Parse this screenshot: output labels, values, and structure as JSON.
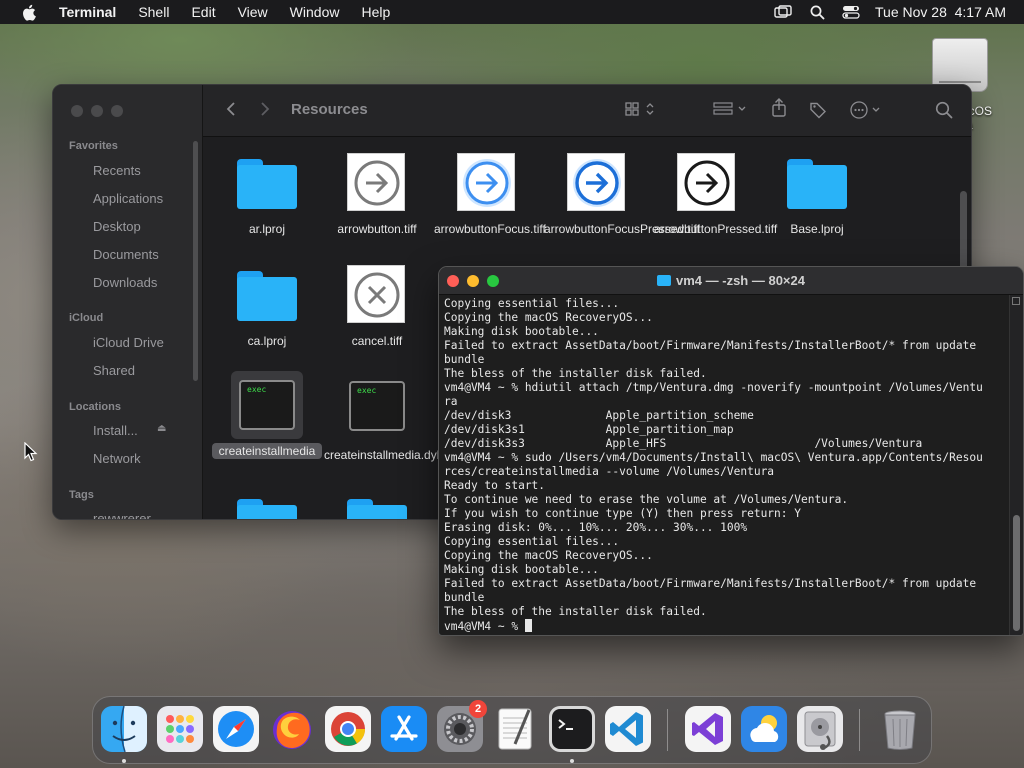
{
  "menubar": {
    "app_name": "Terminal",
    "menus": [
      "Shell",
      "Edit",
      "View",
      "Window",
      "Help"
    ],
    "clock": "Tue Nov 28  4:17 AM"
  },
  "desktop": {
    "volume_label_line1": "acOS",
    "volume_label_line2": "ra"
  },
  "finder": {
    "title": "Resources",
    "sidebar": {
      "favorites_header": "Favorites",
      "favorites": [
        "Recents",
        "Applications",
        "Desktop",
        "Documents",
        "Downloads"
      ],
      "icloud_header": "iCloud",
      "icloud": [
        "iCloud Drive",
        "Shared"
      ],
      "locations_header": "Locations",
      "locations": [
        "Install...",
        "Network"
      ],
      "tags_header": "Tags",
      "tags": [
        "rewwrerer"
      ]
    },
    "files": [
      {
        "name": "ar.lproj",
        "kind": "folder"
      },
      {
        "name": "arrowbutton.tiff",
        "kind": "tiff-arrow"
      },
      {
        "name": "arrowbuttonFocus.tiff",
        "kind": "tiff-arrow-focus"
      },
      {
        "name": "arrowbuttonFocusPressed.tiff",
        "kind": "tiff-arrow-focus-pressed"
      },
      {
        "name": "arrowbuttonPressed.tiff",
        "kind": "tiff-arrow-pressed"
      },
      {
        "name": "Base.lproj",
        "kind": "folder"
      },
      {
        "name": "ca.lproj",
        "kind": "folder"
      },
      {
        "name": "cancel.tiff",
        "kind": "tiff-cancel"
      },
      {
        "name": "createinstallmedia",
        "kind": "exec",
        "selected": true
      },
      {
        "name": "createinstallmedia.dylib",
        "kind": "exec"
      }
    ],
    "exec_label": "exec"
  },
  "terminal": {
    "title": "vm4 — -zsh — 80×24",
    "lines": [
      "Copying essential files...",
      "Copying the macOS RecoveryOS...",
      "Making disk bootable...",
      "Failed to extract AssetData/boot/Firmware/Manifests/InstallerBoot/* from update",
      "bundle",
      "The bless of the installer disk failed.",
      "vm4@VM4 ~ % hdiutil attach /tmp/Ventura.dmg -noverify -mountpoint /Volumes/Ventu",
      "ra",
      "/dev/disk3              Apple_partition_scheme",
      "/dev/disk3s1            Apple_partition_map",
      "/dev/disk3s3            Apple_HFS                      /Volumes/Ventura",
      "vm4@VM4 ~ % sudo /Users/vm4/Documents/Install\\ macOS\\ Ventura.app/Contents/Resou",
      "rces/createinstallmedia --volume /Volumes/Ventura",
      "Ready to start.",
      "To continue we need to erase the volume at /Volumes/Ventura.",
      "If you wish to continue type (Y) then press return: Y",
      "Erasing disk: 0%... 10%... 20%... 30%... 100%",
      "Copying essential files...",
      "Copying the macOS RecoveryOS...",
      "Making disk bootable...",
      "Failed to extract AssetData/boot/Firmware/Manifests/InstallerBoot/* from update",
      "bundle",
      "The bless of the installer disk failed."
    ],
    "prompt": "vm4@VM4 ~ % "
  },
  "dock": {
    "apps": [
      {
        "id": "finder",
        "running": true
      },
      {
        "id": "launchpad",
        "running": false
      },
      {
        "id": "safari",
        "running": false
      },
      {
        "id": "firefox",
        "running": false
      },
      {
        "id": "chrome",
        "running": false
      },
      {
        "id": "app-store",
        "running": false
      },
      {
        "id": "system-settings",
        "running": false,
        "badge": "2"
      },
      {
        "id": "textedit",
        "running": false
      },
      {
        "id": "terminal",
        "running": true
      },
      {
        "id": "vscode",
        "running": false
      },
      {
        "id": "visual-studio",
        "running": false
      },
      {
        "id": "weather",
        "running": false
      },
      {
        "id": "disk-utility",
        "running": false
      },
      {
        "id": "trash",
        "running": false
      }
    ]
  },
  "colors": {
    "folder_blue": "#29b3f8",
    "terminal_bg": "#1e1e1e",
    "close": "#ff5f57",
    "minimize": "#febc2e",
    "zoom": "#28c840"
  }
}
